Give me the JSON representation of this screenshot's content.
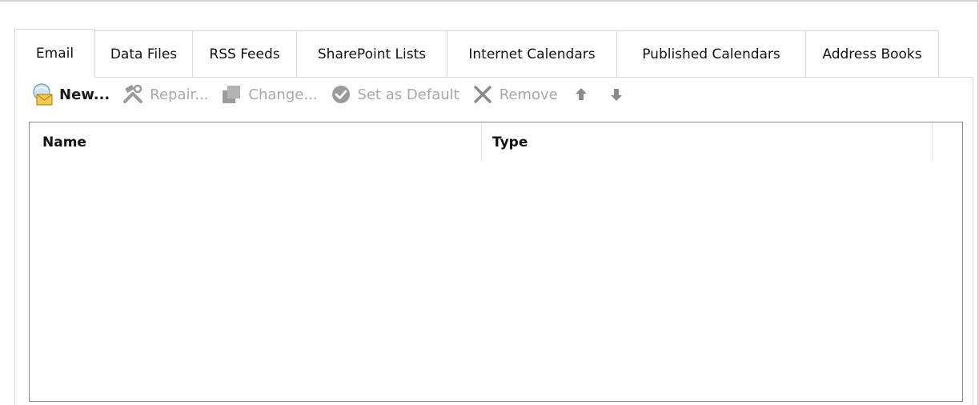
{
  "tabs": [
    {
      "label": "Email",
      "active": true
    },
    {
      "label": "Data Files",
      "active": false
    },
    {
      "label": "RSS Feeds",
      "active": false
    },
    {
      "label": "SharePoint Lists",
      "active": false
    },
    {
      "label": "Internet Calendars",
      "active": false
    },
    {
      "label": "Published Calendars",
      "active": false
    },
    {
      "label": "Address Books",
      "active": false
    }
  ],
  "toolbar": {
    "new_label": "New...",
    "repair_label": "Repair...",
    "change_label": "Change...",
    "set_default_label": "Set as Default",
    "remove_label": "Remove"
  },
  "list": {
    "columns": [
      "Name",
      "Type"
    ],
    "rows": []
  },
  "colors": {
    "disabled_text": "#a8a8a8",
    "tab_border": "#d9d9d9",
    "list_border": "#828790",
    "envelope": "#e8b83c"
  }
}
